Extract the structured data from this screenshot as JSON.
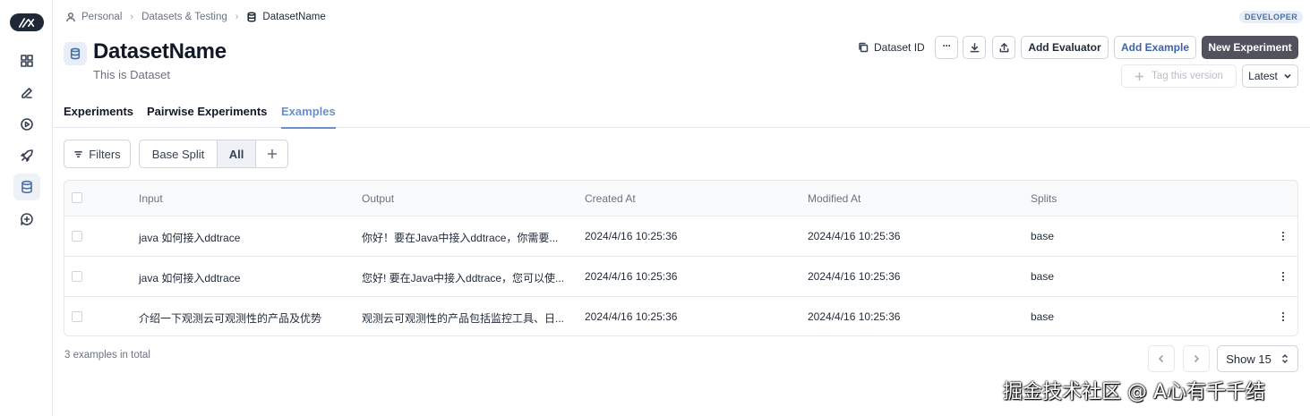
{
  "breadcrumb": {
    "items": [
      "Personal",
      "Datasets & Testing"
    ],
    "current": "DatasetName"
  },
  "badge": "DEVELOPER",
  "title": "DatasetName",
  "subtitle": "This is Dataset",
  "actions": {
    "dataset_id": "Dataset ID",
    "more": "···",
    "add_evaluator": "Add Evaluator",
    "add_example": "Add Example",
    "new_experiment": "New Experiment",
    "tag_version": "Tag this version",
    "version": "Latest"
  },
  "tabs": [
    "Experiments",
    "Pairwise Experiments",
    "Examples"
  ],
  "active_tab": "Examples",
  "filters": {
    "filters_label": "Filters",
    "splits": [
      "Base Split",
      "All"
    ],
    "active_split": "All"
  },
  "table": {
    "columns": [
      "Input",
      "Output",
      "Created At",
      "Modified At",
      "Splits"
    ],
    "rows": [
      {
        "input": "java 如何接入ddtrace",
        "output": "你好！要在Java中接入ddtrace，你需要...",
        "created": "2024/4/16 10:25:36",
        "modified": "2024/4/16 10:25:36",
        "split": "base"
      },
      {
        "input": "java 如何接入ddtrace",
        "output": "您好! 要在Java中接入ddtrace，您可以使...",
        "created": "2024/4/16 10:25:36",
        "modified": "2024/4/16 10:25:36",
        "split": "base"
      },
      {
        "input": "介绍一下观测云可观测性的产品及优势",
        "output": "观测云可观测性的产品包括监控工具、日...",
        "created": "2024/4/16 10:25:36",
        "modified": "2024/4/16 10:25:36",
        "split": "base"
      }
    ]
  },
  "footer": {
    "total": "3 examples in total",
    "page_size": "Show 15"
  },
  "watermark": "掘金技术社区 @ A心有千千结",
  "colors": {
    "accent": "#6b8fc9",
    "primary_button": "#52525e",
    "link_blue": "#3b63a8"
  }
}
